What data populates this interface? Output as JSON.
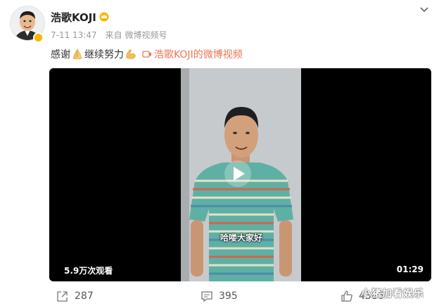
{
  "post": {
    "author": "浩歌KOJI",
    "author_icon": "crown-badge-icon",
    "verified_icon": "verified-badge-icon",
    "time": "7-11 13:47",
    "source_prefix": "来自",
    "source": "微博视频号",
    "text_part1": "感谢",
    "emoji1": "pray-hands-icon",
    "text_part2": "继续努力",
    "emoji2": "flexed-bicep-icon",
    "video_link": "浩歌KOJI的微博视频"
  },
  "video": {
    "views": "5.9万次观看",
    "duration": "01:29",
    "subtitle": "哈喽大家好",
    "play_icon": "play-icon"
  },
  "actions": {
    "repost_count": "287",
    "comment_count": "395",
    "like_count": "4386"
  },
  "watermark": "小猪加看娱乐",
  "colors": {
    "link": "#eb7350",
    "badge": "#f7b500",
    "video_bg": "#000000",
    "shirt_teal": "#5fb0a4"
  }
}
